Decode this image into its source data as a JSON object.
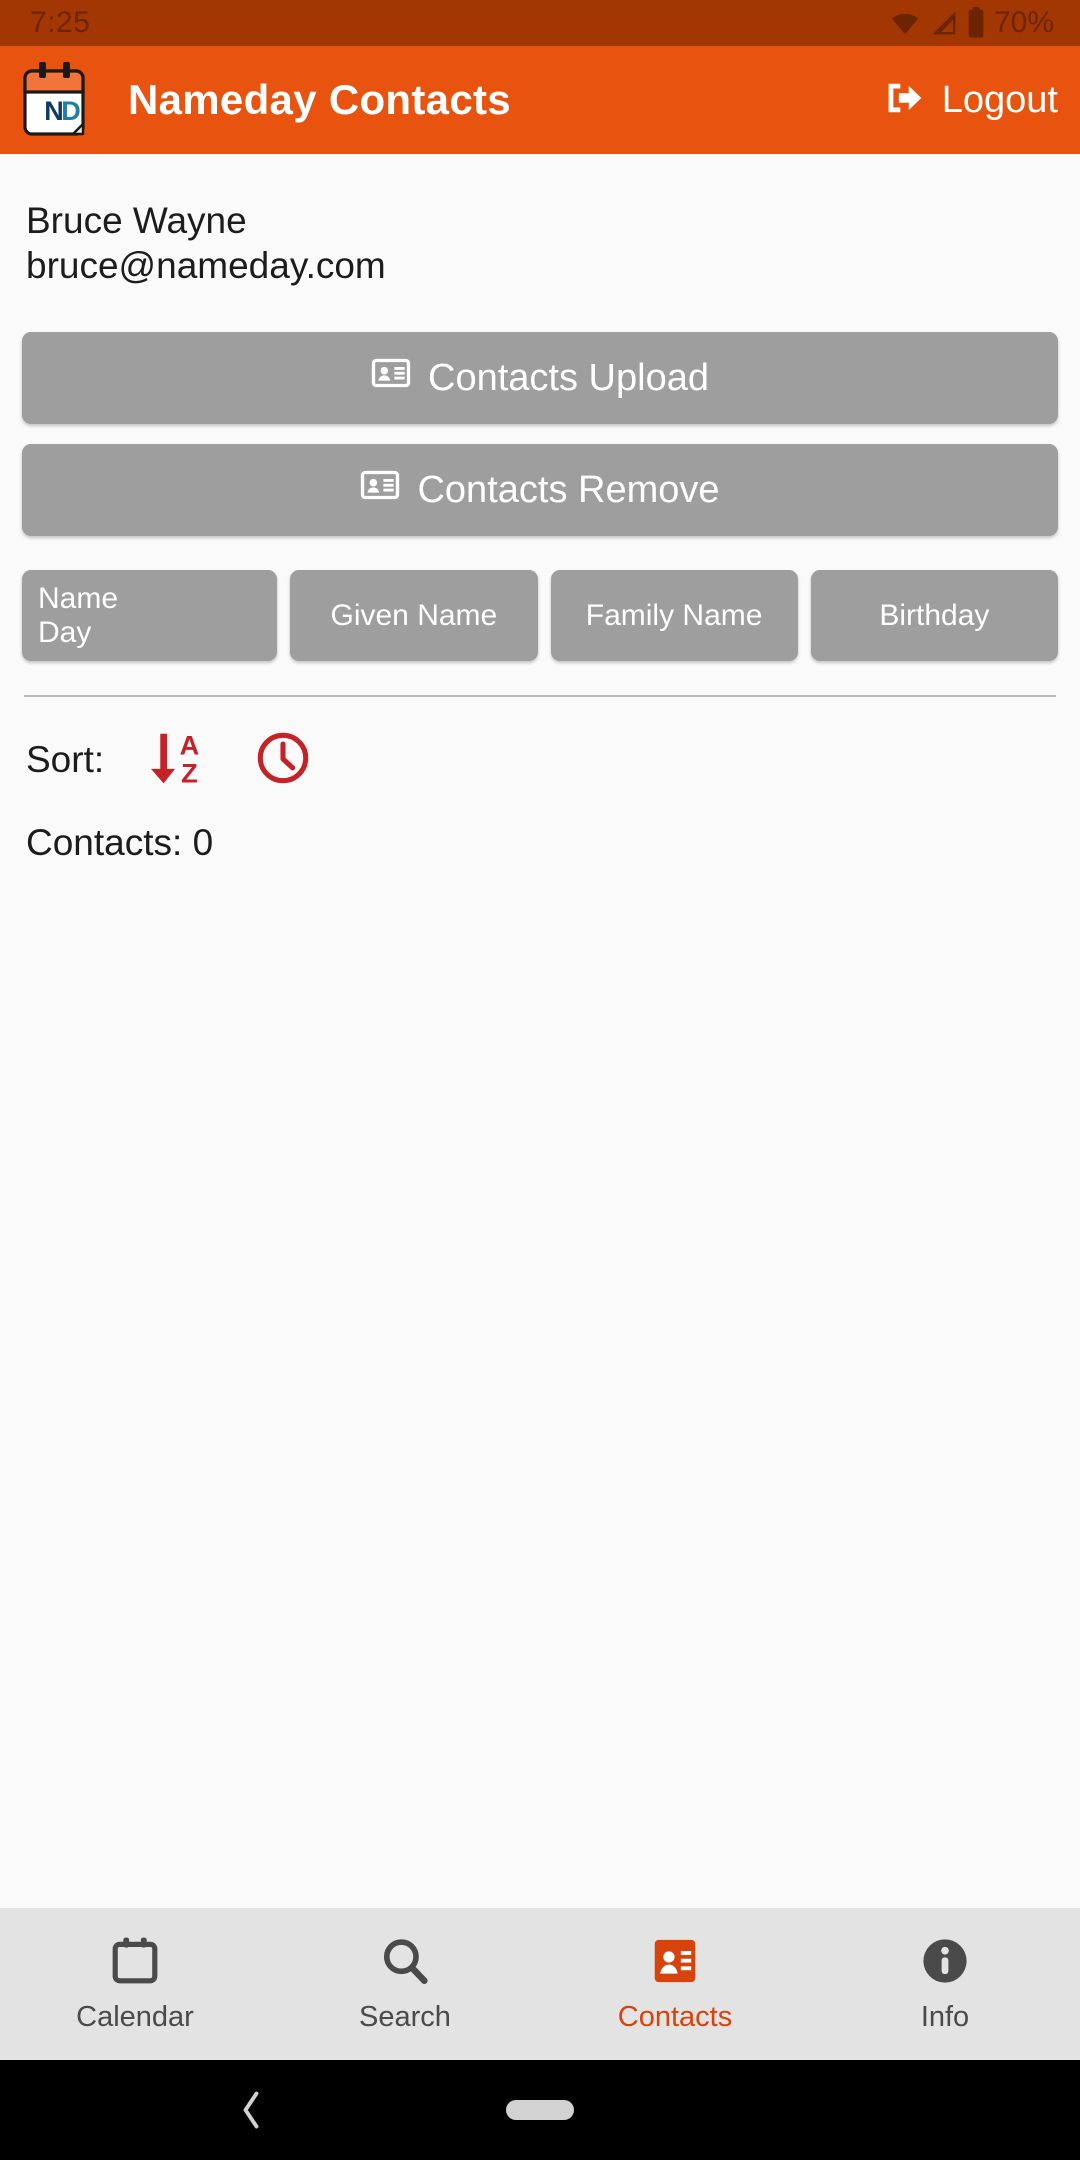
{
  "status_bar": {
    "clock": "7:25",
    "battery_percent": "70%",
    "icons": [
      "wifi-icon",
      "cellular-signal-icon",
      "battery-icon"
    ]
  },
  "app_bar": {
    "logo_icon": "nameday-calendar-logo",
    "logo_text": "ND",
    "title": "Nameday Contacts",
    "logout_label": "Logout",
    "logout_icon": "sign-out-icon",
    "background_color": "#e8530f"
  },
  "user": {
    "name": "Bruce Wayne",
    "email": "bruce@nameday.com"
  },
  "actions": {
    "upload_label": "Contacts Upload",
    "upload_icon": "contact-card-icon",
    "remove_label": "Contacts Remove",
    "remove_icon": "contact-card-icon"
  },
  "column_tabs": [
    {
      "label": "Name\nDay"
    },
    {
      "label": "Given Name"
    },
    {
      "label": "Family Name"
    },
    {
      "label": "Birthday"
    }
  ],
  "sort": {
    "label": "Sort:",
    "alpha_icon": "sort-alpha-down-icon",
    "clock_icon": "clock-icon",
    "accent_color": "#c62127"
  },
  "contacts_summary": "Contacts: 0",
  "bottom_nav": {
    "active_color": "#d6430d",
    "items": [
      {
        "label": "Calendar",
        "icon": "calendar-icon",
        "active": false
      },
      {
        "label": "Search",
        "icon": "search-icon",
        "active": false
      },
      {
        "label": "Contacts",
        "icon": "contacts-card-icon",
        "active": true
      },
      {
        "label": "Info",
        "icon": "info-circle-icon",
        "active": false
      }
    ]
  },
  "system_nav": {
    "back_icon": "back-chevron-icon",
    "home_icon": "home-pill-icon"
  }
}
